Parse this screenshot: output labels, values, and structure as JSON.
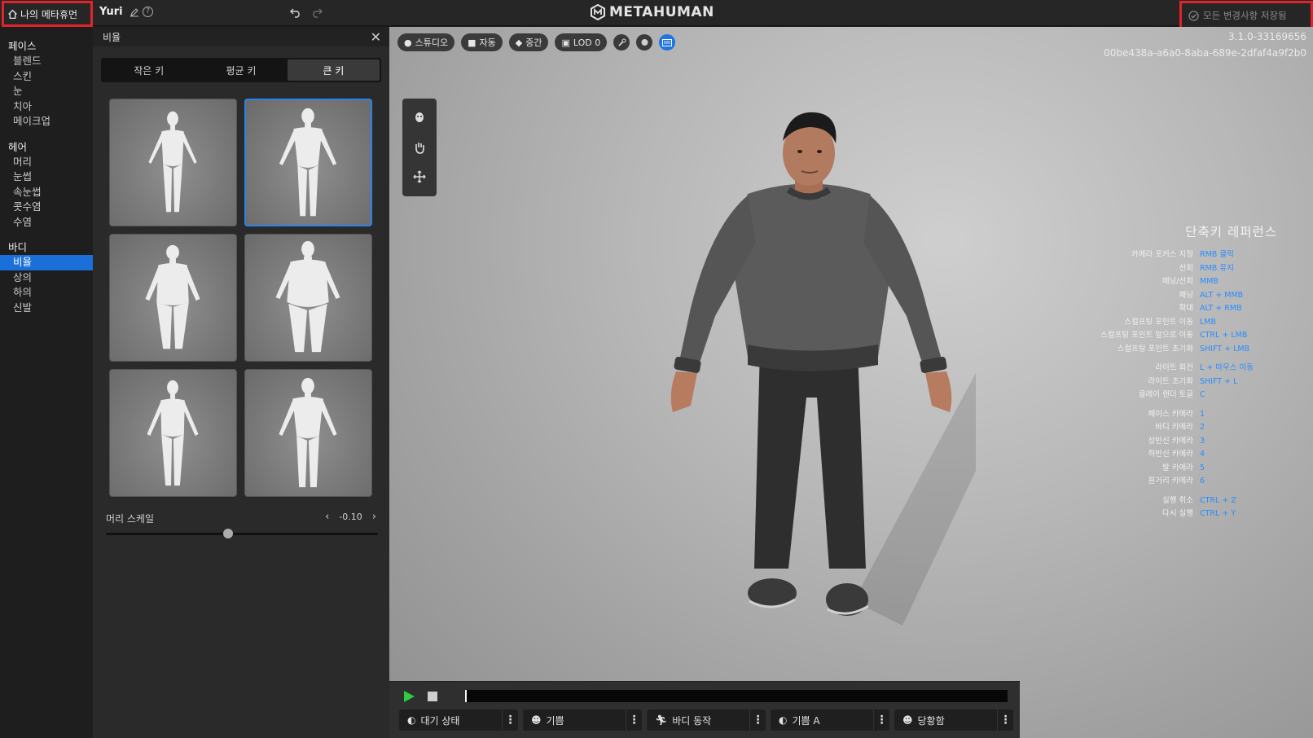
{
  "topbar": {
    "home_label": "나의 메타휴먼",
    "character_name": "Yuri",
    "logo_text": "METAHUMAN",
    "save_status": "모든 변경사항 저장됨"
  },
  "nav": {
    "face": {
      "title": "페이스",
      "items": [
        "블렌드",
        "스킨",
        "눈",
        "치아",
        "메이크업"
      ]
    },
    "hair": {
      "title": "헤어",
      "items": [
        "머리",
        "눈썹",
        "속눈썹",
        "콧수염",
        "수염"
      ]
    },
    "body": {
      "title": "바디",
      "items": [
        "비율",
        "상의",
        "하의",
        "신발"
      ],
      "active": "비율"
    }
  },
  "panel": {
    "title": "비율",
    "tabs": [
      "작은 키",
      "평균 키",
      "큰 키"
    ],
    "active_tab": "큰 키",
    "presets_count": 6,
    "selected_preset": 2,
    "slider": {
      "label": "머리 스케일",
      "value": "-0.10",
      "fraction": 0.45
    }
  },
  "viewport": {
    "toolbar": {
      "lighting": "스튜디오",
      "camera": "자동",
      "quality": "중간",
      "lod": "LOD 0"
    },
    "version": "3.1.0-33169656",
    "asset_id": "00be438a-a6a0-8aba-689e-2dfaf4a9f2b0",
    "shortcuts": {
      "title": "단축키 레퍼런스",
      "groups": [
        [
          {
            "k": "카메라 포커스 지정",
            "v": "RMB 클릭"
          },
          {
            "k": "선회",
            "v": "RMB 유지"
          },
          {
            "k": "패닝/선회",
            "v": "MMB"
          },
          {
            "k": "패닝",
            "v": "ALT + MMB"
          },
          {
            "k": "확대",
            "v": "ALT + RMB"
          },
          {
            "k": "스컬프팅 포인트 이동",
            "v": "LMB"
          },
          {
            "k": "스컬프팅 포인트 앞으로 이동",
            "v": "CTRL + LMB"
          },
          {
            "k": "스컬프팅 포인트 초기화",
            "v": "SHIFT + LMB"
          }
        ],
        [
          {
            "k": "라이트 회전",
            "v": "L + 마우스 이동"
          },
          {
            "k": "라이트 초기화",
            "v": "SHIFT + L"
          },
          {
            "k": "클레이 렌더 토글",
            "v": "C"
          }
        ],
        [
          {
            "k": "페이스 카메라",
            "v": "1"
          },
          {
            "k": "바디 카메라",
            "v": "2"
          },
          {
            "k": "상반신 카메라",
            "v": "3"
          },
          {
            "k": "하반신 카메라",
            "v": "4"
          },
          {
            "k": "발 카메라",
            "v": "5"
          },
          {
            "k": "원거리 카메라",
            "v": "6"
          }
        ],
        [
          {
            "k": "실행 취소",
            "v": "CTRL + Z"
          },
          {
            "k": "다시 실행",
            "v": "CTRL + Y"
          }
        ]
      ]
    }
  },
  "timeline": {
    "animations": [
      "대기 상태",
      "기쁨",
      "바디 동작",
      "기쁨 A",
      "당황함"
    ]
  },
  "colors": {
    "accent": "#1a6fd8",
    "highlight_box": "#e0242c",
    "shortcut_value": "#2a8cff"
  }
}
